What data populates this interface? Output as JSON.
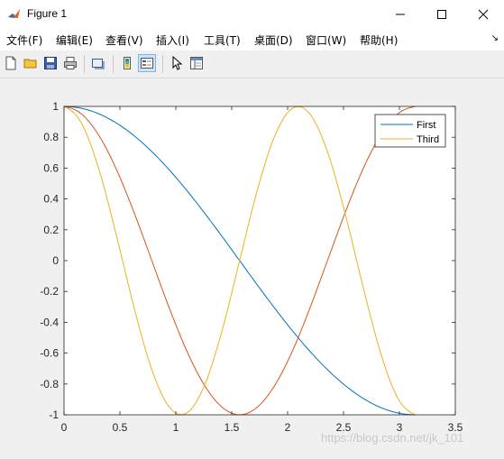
{
  "window": {
    "title": "Figure 1",
    "controls": {
      "minimize": "—",
      "maximize": "☐",
      "close": "✕"
    }
  },
  "menu": {
    "items": [
      {
        "label": "文件(F)"
      },
      {
        "label": "编辑(E)"
      },
      {
        "label": "查看(V)"
      },
      {
        "label": "插入(I)"
      },
      {
        "label": "工具(T)"
      },
      {
        "label": "桌面(D)"
      },
      {
        "label": "窗口(W)"
      },
      {
        "label": "帮助(H)"
      }
    ],
    "overflow_icon": "dock-arrow-icon"
  },
  "toolbar": {
    "buttons": [
      {
        "icon": "new-figure-icon"
      },
      {
        "icon": "open-file-icon"
      },
      {
        "icon": "save-icon"
      },
      {
        "icon": "print-icon"
      },
      {
        "icon": "link-plot-icon"
      },
      {
        "icon": "colorbar-icon"
      },
      {
        "icon": "legend-icon",
        "active": true
      },
      {
        "icon": "pointer-icon"
      },
      {
        "icon": "property-editor-icon"
      }
    ]
  },
  "watermark": "https://blog.csdn.net/jk_101",
  "chart_data": {
    "type": "line",
    "title": "",
    "xlabel": "",
    "ylabel": "",
    "xlim": [
      0,
      3.5
    ],
    "ylim": [
      -1,
      1
    ],
    "xticks": [
      "0",
      "0.5",
      "1",
      "1.5",
      "2",
      "2.5",
      "3",
      "3.5"
    ],
    "yticks": [
      "1",
      "0.8",
      "0.6",
      "0.4",
      "0.2",
      "0",
      "-0.2",
      "-0.4",
      "-0.6",
      "-0.8",
      "-1"
    ],
    "x": [
      0,
      0.1571,
      0.3142,
      0.4712,
      0.6283,
      0.7854,
      0.9425,
      1.0996,
      1.2566,
      1.4137,
      1.5708,
      1.7279,
      1.885,
      2.042,
      2.1991,
      2.3562,
      2.5133,
      2.6704,
      2.8274,
      2.9845,
      3.1416
    ],
    "series": [
      {
        "name": "First",
        "color": "#0072BD",
        "values": [
          1,
          0.9877,
          0.9511,
          0.891,
          0.809,
          0.7071,
          0.5878,
          0.454,
          0.309,
          0.1564,
          0,
          -0.1564,
          -0.309,
          -0.454,
          -0.5878,
          -0.7071,
          -0.809,
          -0.891,
          -0.9511,
          -0.9877,
          -1
        ]
      },
      {
        "color": "#D95319",
        "values": [
          1,
          0.9511,
          0.809,
          0.5878,
          0.309,
          0,
          -0.309,
          -0.5878,
          -0.809,
          -0.9511,
          -1,
          -0.9511,
          -0.809,
          -0.5878,
          -0.309,
          0,
          0.309,
          0.5878,
          0.809,
          0.9511,
          1
        ]
      },
      {
        "name": "Third",
        "color": "#EDB120",
        "values": [
          1,
          0.891,
          0.5878,
          0.1564,
          -0.309,
          -0.7071,
          -0.9511,
          -0.9877,
          -0.809,
          -0.454,
          0,
          0.454,
          0.809,
          0.9877,
          0.9511,
          0.7071,
          0.309,
          -0.1564,
          -0.5878,
          -0.891,
          -1
        ]
      }
    ],
    "legend": {
      "position": "top-right",
      "entries": [
        "First",
        "Third"
      ]
    },
    "grid": false
  }
}
